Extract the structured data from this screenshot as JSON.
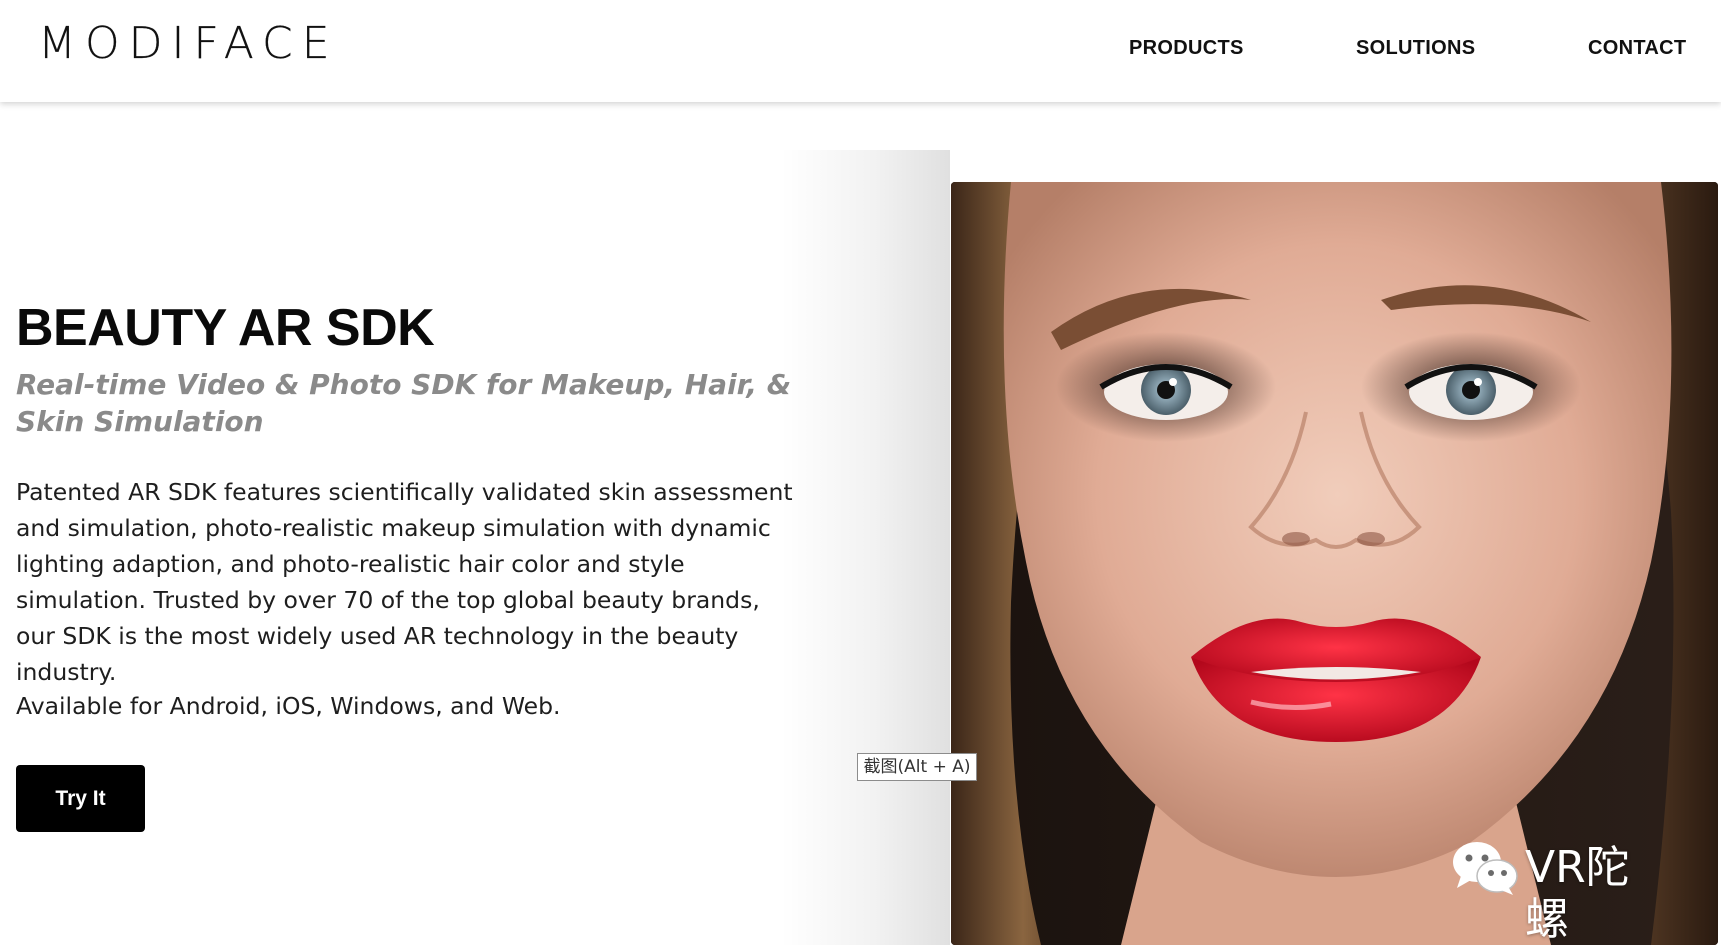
{
  "header": {
    "logo": "MODIFACE",
    "nav": [
      "PRODUCTS",
      "SOLUTIONS",
      "CONTACT"
    ]
  },
  "hero": {
    "title": "BEAUTY AR SDK",
    "subtitle": "Real-time Video & Photo SDK for Makeup, Hair, & Skin Simulation",
    "description": "Patented AR SDK features scientifically validated skin assessment and simulation, photo-realistic makeup simulation with dynamic lighting adaption, and photo-realistic hair color and style simulation. Trusted by over 70 of the top global beauty brands, our SDK is the most widely used AR technology in the beauty industry.",
    "availability": "Available for Android, iOS, Windows, and Web.",
    "cta_label": "Try It"
  },
  "tooltip": "截图(Alt + A)",
  "watermark": {
    "text": "VR陀螺",
    "icon": "wechat-icon"
  },
  "colors": {
    "text": "#111111",
    "subtitle": "#8a8a8a",
    "button_bg": "#000000",
    "button_text": "#ffffff",
    "lips": "#d8132a"
  }
}
